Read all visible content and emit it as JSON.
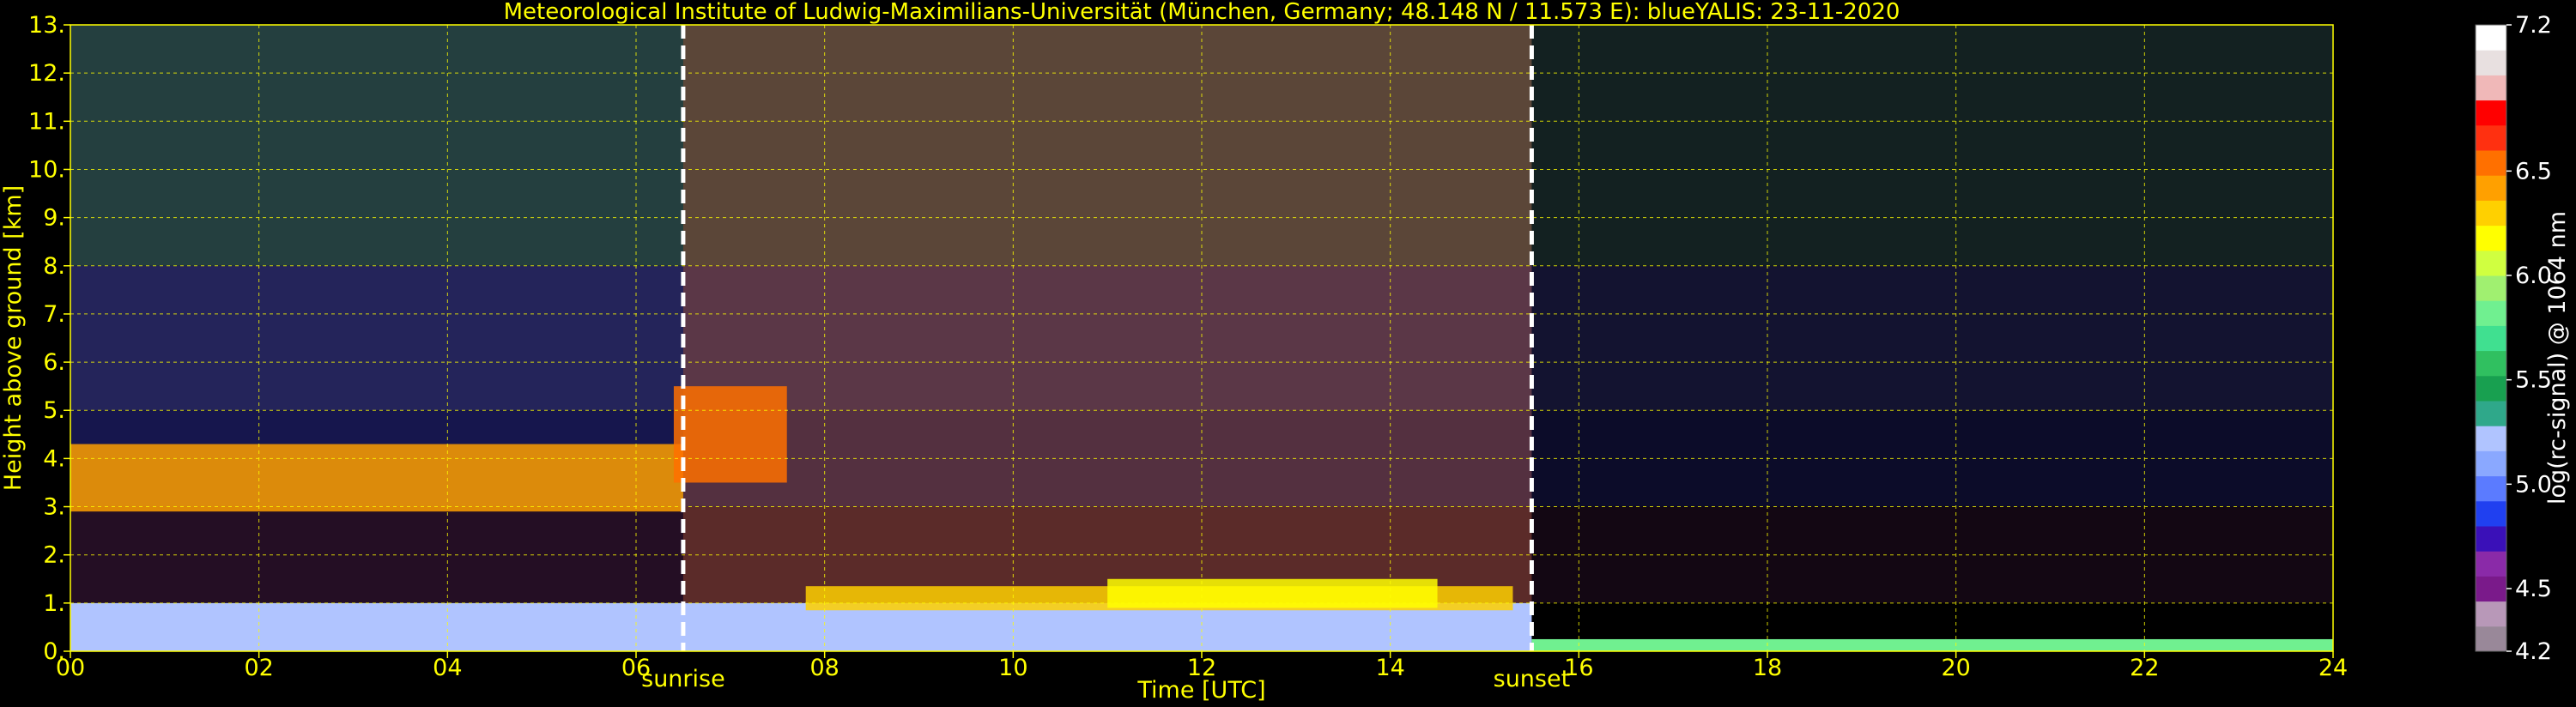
{
  "chart_data": {
    "type": "heatmap",
    "title": "Meteorological Institute of Ludwig-Maximilians-Universität (München, Germany; 48.148 N / 11.573 E):     blueYALIS: 23-11-2020",
    "xlabel": "Time [UTC]",
    "ylabel": "Height above ground [km]",
    "xlim": [
      0,
      24
    ],
    "ylim": [
      0,
      13
    ],
    "x_ticks": [
      0,
      2,
      4,
      6,
      8,
      10,
      12,
      14,
      16,
      18,
      20,
      22,
      24
    ],
    "x_tick_labels": [
      "00",
      "02",
      "04",
      "06",
      "08",
      "10",
      "12",
      "14",
      "16",
      "18",
      "20",
      "22",
      "24"
    ],
    "y_ticks": [
      0,
      1,
      2,
      3,
      4,
      5,
      6,
      7,
      8,
      9,
      10,
      11,
      12,
      13
    ],
    "y_tick_labels": [
      "0.",
      "1.",
      "2.",
      "3.",
      "4.",
      "5.",
      "6.",
      "7.",
      "8.",
      "9.",
      "10.",
      "11.",
      "12.",
      "13."
    ],
    "grid": true,
    "annotations": [
      {
        "label": "sunrise",
        "x": 6.5
      },
      {
        "label": "sunset",
        "x": 15.5
      }
    ],
    "colorbar": {
      "label": "log(rc-signal) @ 1064 nm",
      "range": [
        4.2,
        7.2
      ],
      "tick_values": [
        4.2,
        4.5,
        5.0,
        5.5,
        6.0,
        6.5,
        7.2
      ],
      "tick_labels": [
        "4.2",
        "4.5",
        "5.0",
        "5.5",
        "6.0",
        "6.5",
        "7.2"
      ],
      "colors": [
        "#998899",
        "#b898b8",
        "#7a1a8a",
        "#8a2aa8",
        "#3a10b8",
        "#2040f0",
        "#5b7bff",
        "#8aa8ff",
        "#b0c4ff",
        "#2fa88a",
        "#18a050",
        "#30c060",
        "#40e090",
        "#70f090",
        "#a0f070",
        "#d0ff40",
        "#ffff00",
        "#ffd000",
        "#ffa000",
        "#ff7000",
        "#ff3010",
        "#ff0000",
        "#f0b8b8",
        "#e8e0e0",
        "#ffffff"
      ]
    },
    "cloud_layers": [
      {
        "t0": 0.0,
        "t1": 6.5,
        "z": 3.6,
        "thickness": 1.4,
        "intensity": 6.4
      },
      {
        "t0": 6.4,
        "t1": 7.6,
        "z": 4.5,
        "thickness": 2.0,
        "intensity": 6.5
      },
      {
        "t0": 7.8,
        "t1": 15.3,
        "z": 1.1,
        "thickness": 0.5,
        "intensity": 6.3
      },
      {
        "t0": 11.0,
        "t1": 14.5,
        "z": 1.2,
        "thickness": 0.6,
        "intensity": 6.2
      }
    ],
    "boundary_layer": [
      {
        "t0": 0.0,
        "t1": 15.5,
        "z_top": 1.0,
        "intensity": 5.2
      },
      {
        "t0": 15.5,
        "t1": 24.0,
        "z_top": 0.25,
        "intensity": 5.8
      }
    ]
  }
}
